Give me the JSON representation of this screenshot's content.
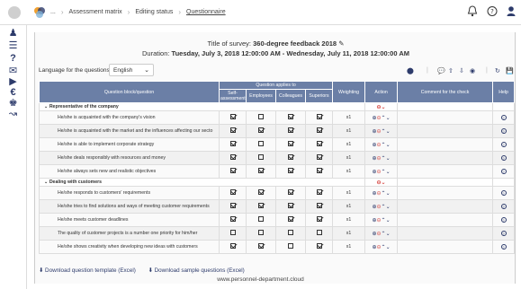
{
  "breadcrumb": {
    "root": "...",
    "items": [
      "Assessment matrix",
      "Editing status",
      "Questionnaire"
    ]
  },
  "survey": {
    "title_label": "Title of survey:",
    "title_value": "360-degree feedback 2018",
    "duration_label": "Duration:",
    "duration_value": "Tuesday, July 3, 2018 12:00:00 AM - Wednesday, July 11, 2018 12:00:00 AM"
  },
  "language": {
    "label": "Language for the questions:",
    "selected": "English"
  },
  "table": {
    "headers": {
      "block": "Question block/question",
      "applies_to": "Question applies to",
      "self": "Self-assessment",
      "employees": "Employees",
      "colleagues": "Colleagues",
      "superiors": "Superiors",
      "weighting": "Weighting",
      "action": "Action",
      "comment": "Comment for the check",
      "help": "Help"
    },
    "sections": [
      {
        "title": "Representative of the company",
        "rows": [
          {
            "q": "He/she is acquainted with the company's vision",
            "self": true,
            "emp": false,
            "col": true,
            "sup": true,
            "w": "x1"
          },
          {
            "q": "He/she is acquainted with the market and the influences affecting our secto",
            "self": true,
            "emp": true,
            "col": true,
            "sup": true,
            "w": "x1"
          },
          {
            "q": "He/she is able to implement corporate strategy",
            "self": true,
            "emp": false,
            "col": true,
            "sup": true,
            "w": "x1"
          },
          {
            "q": "He/she deals responsibly with resources and money",
            "self": true,
            "emp": false,
            "col": true,
            "sup": true,
            "w": "x1"
          },
          {
            "q": "He/she always sets new and realistic objectives",
            "self": true,
            "emp": true,
            "col": true,
            "sup": true,
            "w": "x1"
          }
        ]
      },
      {
        "title": "Dealing with customers",
        "rows": [
          {
            "q": "He/she responds to customers' requirements",
            "self": true,
            "emp": true,
            "col": true,
            "sup": true,
            "w": "x1"
          },
          {
            "q": "He/she tries to find solutions and ways of meeting customer requirements",
            "self": true,
            "emp": true,
            "col": true,
            "sup": true,
            "w": "x1"
          },
          {
            "q": "He/she meets customer deadlines",
            "self": true,
            "emp": false,
            "col": true,
            "sup": true,
            "w": "x1"
          },
          {
            "q": "The quality of customer projects is a number one priority for him/her",
            "self": false,
            "emp": false,
            "col": false,
            "sup": false,
            "w": "x1"
          },
          {
            "q": "He/she shows creativity when developing new ideas with customers",
            "self": true,
            "emp": true,
            "col": false,
            "sup": true,
            "w": "x1"
          }
        ]
      }
    ]
  },
  "downloads": {
    "template": "Download question template (Excel)",
    "sample": "Download sample questions (Excel)"
  },
  "footer": "www.personnel-department.cloud"
}
